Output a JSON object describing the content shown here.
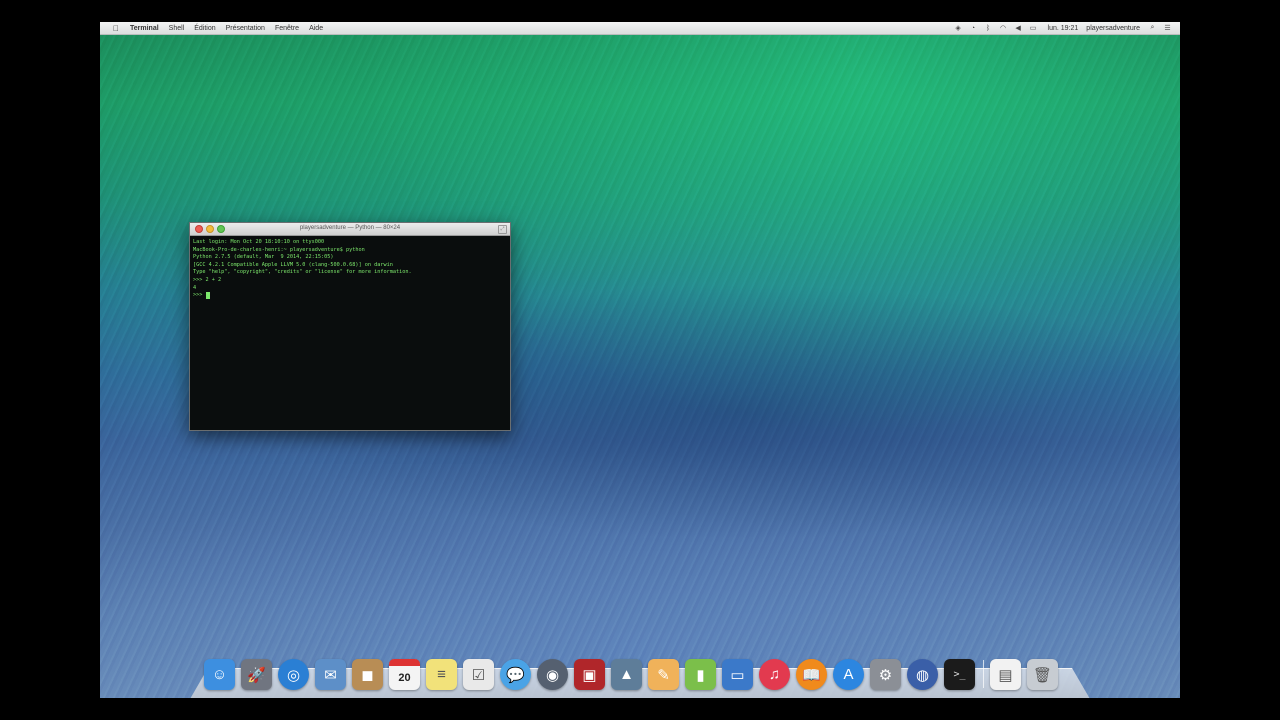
{
  "menubar": {
    "apple": "",
    "items": [
      "Terminal",
      "Shell",
      "Édition",
      "Présentation",
      "Fenêtre",
      "Aide"
    ],
    "clock": "lun. 19:21",
    "user": "playersadventure",
    "status_icons": [
      "dropbox-icon",
      "sync-icon",
      "bluetooth-icon",
      "wifi-icon",
      "volume-icon",
      "battery-icon"
    ]
  },
  "terminal": {
    "title": "playersadventure — Python — 80×24",
    "lines": [
      "Last login: Mon Oct 20 18:10:10 on ttys000",
      "MacBook-Pro-de-charles-henri:~ playersadventure$ python",
      "Python 2.7.5 (default, Mar  9 2014, 22:15:05)",
      "[GCC 4.2.1 Compatible Apple LLVM 5.0 (clang-500.0.68)] on darwin",
      "Type \"help\", \"copyright\", \"credits\" or \"license\" for more information.",
      ">>> 2 + 2",
      "4",
      ">>> "
    ]
  },
  "dock": {
    "calendar_day": "20",
    "items": [
      {
        "name": "finder-icon",
        "color": "#3d8fe0",
        "glyph": "☺"
      },
      {
        "name": "launchpad-icon",
        "color": "#707580",
        "glyph": "🚀"
      },
      {
        "name": "safari-icon",
        "color": "#2a7fd4",
        "glyph": "◎"
      },
      {
        "name": "mail-icon",
        "color": "#5d8fc8",
        "glyph": "✉"
      },
      {
        "name": "contacts-icon",
        "color": "#b88d55",
        "glyph": "◼"
      },
      {
        "name": "calendar-icon",
        "color": "#f4f4f4",
        "glyph": ""
      },
      {
        "name": "notes-icon",
        "color": "#f2e27a",
        "glyph": "≡"
      },
      {
        "name": "reminders-icon",
        "color": "#e9e9e9",
        "glyph": "☑"
      },
      {
        "name": "messages-icon",
        "color": "#4aa3e6",
        "glyph": "💬"
      },
      {
        "name": "facetime-icon",
        "color": "#556070",
        "glyph": "◉"
      },
      {
        "name": "photo-booth-icon",
        "color": "#b0262a",
        "glyph": "▣"
      },
      {
        "name": "iphoto-icon",
        "color": "#5e7d99",
        "glyph": "▲"
      },
      {
        "name": "pages-icon",
        "color": "#f0b25a",
        "glyph": "✎"
      },
      {
        "name": "numbers-icon",
        "color": "#7bbf4a",
        "glyph": "▮"
      },
      {
        "name": "keynote-icon",
        "color": "#3b79c9",
        "glyph": "▭"
      },
      {
        "name": "itunes-icon",
        "color": "#e23a4f",
        "glyph": "♫"
      },
      {
        "name": "ibooks-icon",
        "color": "#f08a1c",
        "glyph": "📖"
      },
      {
        "name": "app-store-icon",
        "color": "#2c86e0",
        "glyph": "A"
      },
      {
        "name": "system-preferences-icon",
        "color": "#8b8f96",
        "glyph": "⚙"
      },
      {
        "name": "network-icon",
        "color": "#3a5fa8",
        "glyph": "◍"
      },
      {
        "name": "terminal-icon",
        "color": "#1b1b1b",
        "glyph": ">_"
      }
    ],
    "right_items": [
      {
        "name": "documents-icon",
        "color": "#f2f2f2",
        "glyph": "▤"
      },
      {
        "name": "trash-icon",
        "color": "#c7ccd2",
        "glyph": "🗑"
      }
    ]
  }
}
